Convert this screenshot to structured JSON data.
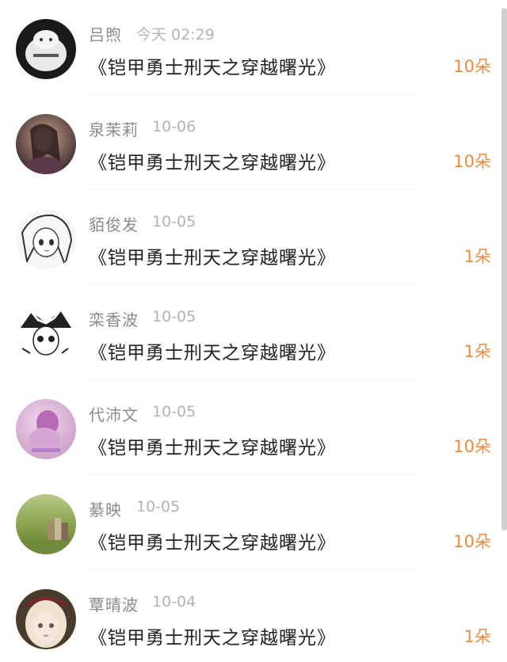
{
  "accent_color": "#f08a3c",
  "items": [
    {
      "name": "吕煦",
      "time": "今天 02:29",
      "book": "《铠甲勇士刑天之穿越曙光》",
      "amount": "10朵",
      "avatar_icon": "avatar-dog-sweater"
    },
    {
      "name": "泉茉莉",
      "time": "10-06",
      "book": "《铠甲勇士刑天之穿越曙光》",
      "amount": "10朵",
      "avatar_icon": "avatar-girl-photo"
    },
    {
      "name": "貊俊发",
      "time": "10-05",
      "book": "《铠甲勇士刑天之穿越曙光》",
      "amount": "1朵",
      "avatar_icon": "avatar-anime-girl"
    },
    {
      "name": "栾香波",
      "time": "10-05",
      "book": "《铠甲勇士刑天之穿越曙光》",
      "amount": "1朵",
      "avatar_icon": "avatar-anime-jester"
    },
    {
      "name": "代沛文",
      "time": "10-05",
      "book": "《铠甲勇士刑天之穿越曙光》",
      "amount": "10朵",
      "avatar_icon": "avatar-purple-girl"
    },
    {
      "name": "綦映",
      "time": "10-05",
      "book": "《铠甲勇士刑天之穿越曙光》",
      "amount": "10朵",
      "avatar_icon": "avatar-field-books"
    },
    {
      "name": "覃晴波",
      "time": "10-04",
      "book": "《铠甲勇士刑天之穿越曙光》",
      "amount": "1朵",
      "avatar_icon": "avatar-doll"
    }
  ]
}
